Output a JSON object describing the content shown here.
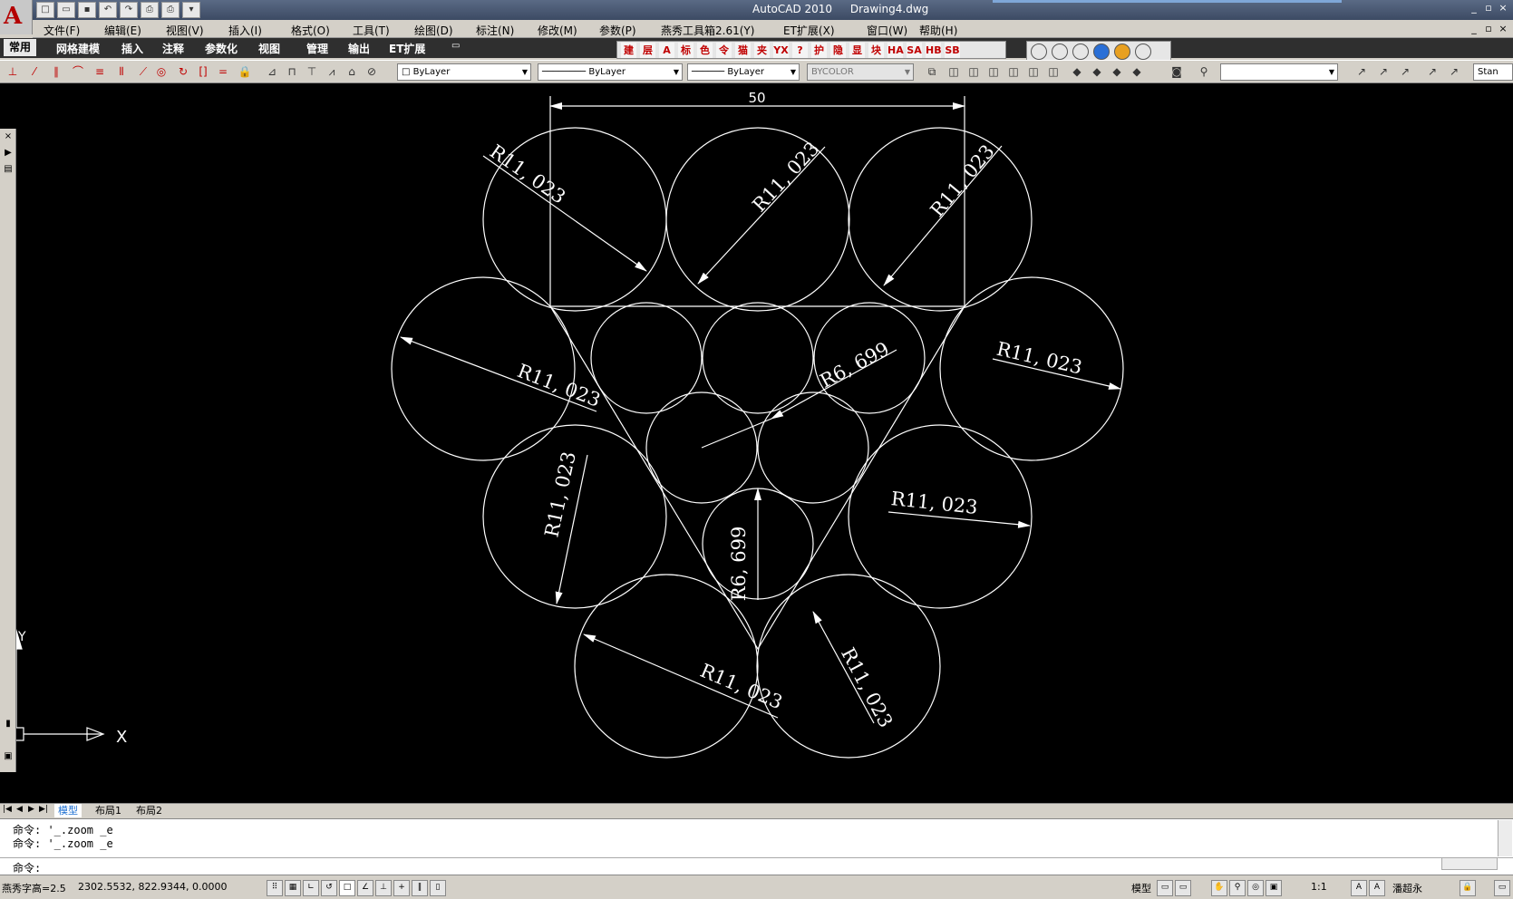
{
  "app": {
    "title": "AutoCAD 2010",
    "document": "Drawing4.dwg"
  },
  "colors": {
    "canvas_bg": "#000000",
    "geometry": "#ffffff",
    "title_bar": "#4a5873",
    "ribbon_bg": "#2f2f2f",
    "model_tab": "#1d6fd1"
  },
  "menu": [
    "文件(F)",
    "编辑(E)",
    "视图(V)",
    "插入(I)",
    "格式(O)",
    "工具(T)",
    "绘图(D)",
    "标注(N)",
    "修改(M)",
    "参数(P)",
    "燕秀工具箱2.61(Y)",
    "ET扩展(X)",
    "窗口(W)",
    "帮助(H)"
  ],
  "ribbon_tabs": [
    "常用",
    "网格建模",
    "插入",
    "注释",
    "参数化",
    "视图",
    "管理",
    "输出",
    "ET扩展"
  ],
  "yanxiu_tools": [
    "建",
    "层",
    "A",
    "标",
    "色",
    "令",
    "猫",
    "夹",
    "YX",
    "?",
    "护",
    "隐",
    "显",
    "块",
    "HA",
    "SA",
    "HB",
    "SB"
  ],
  "properties": {
    "layer": "ByLayer",
    "linetype": "ByLayer",
    "lineweight": "ByLayer",
    "plotstyle": "BYCOLOR",
    "textstyle": "Stan"
  },
  "drawing": {
    "dimension_linear": "50",
    "dims": [
      "R11, 023",
      "R11, 023",
      "R11, 023",
      "R11, 023",
      "R11, 023",
      "R11, 023",
      "R11, 023",
      "R11, 023",
      "R11, 023",
      "R6, 699",
      "R6, 699"
    ],
    "ucs_x": "X",
    "ucs_y": "Y"
  },
  "layout_tabs": [
    "模型",
    "布局1",
    "布局2"
  ],
  "command_history": [
    "命令: '_.zoom _e",
    "命令: '_.zoom _e"
  ],
  "command_prompt": "命令:",
  "status": {
    "text_height": "燕秀字高=2.5",
    "coords": "2302.5532, 822.9344, 0.0000",
    "model_label": "模型",
    "annotation_scale": "1:1",
    "workspace": "潘超永"
  }
}
